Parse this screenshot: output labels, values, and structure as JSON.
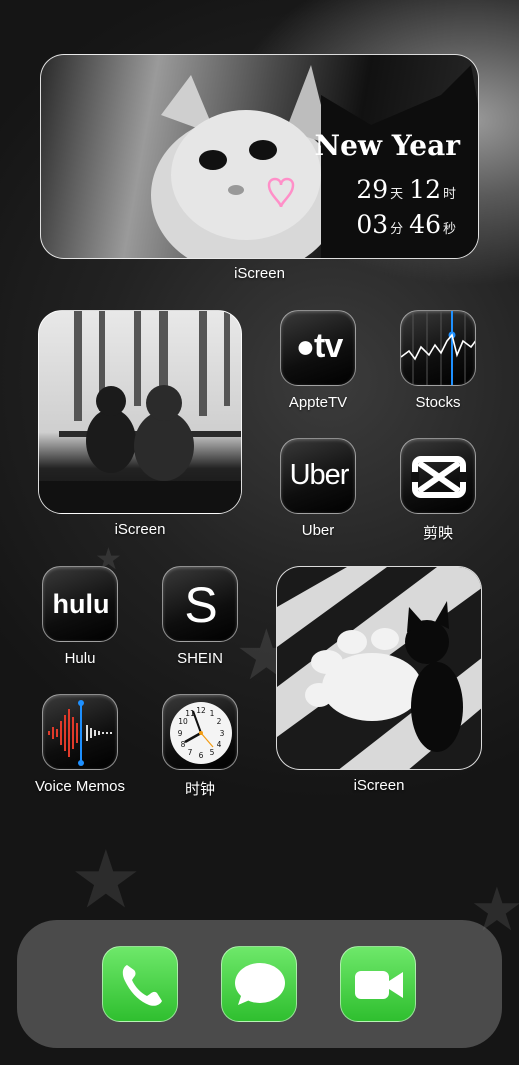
{
  "widgets": {
    "new_year": {
      "title": "New Year",
      "days": "29",
      "days_unit": "天",
      "hours": "12",
      "hours_unit": "时",
      "minutes": "03",
      "minutes_unit": "分",
      "seconds": "46",
      "seconds_unit": "秒",
      "label": "iScreen"
    },
    "snow_cats": {
      "label": "iScreen"
    },
    "black_cat": {
      "label": "iScreen"
    }
  },
  "apps": {
    "appletv": {
      "label": "AppteTV",
      "icon": "apple-tv-icon",
      "glyph_text": "tv"
    },
    "stocks": {
      "label": "Stocks",
      "icon": "stocks-icon"
    },
    "uber": {
      "label": "Uber",
      "icon": "uber-icon",
      "glyph_text": "Uber"
    },
    "capcut": {
      "label": "剪映",
      "icon": "capcut-icon"
    },
    "hulu": {
      "label": "Hulu",
      "icon": "hulu-icon",
      "glyph_text": "hulu"
    },
    "shein": {
      "label": "SHEIN",
      "icon": "shein-icon",
      "glyph_text": "S"
    },
    "voice_memos": {
      "label": "Voice Memos",
      "icon": "voice-memos-icon"
    },
    "clock": {
      "label": "时钟",
      "icon": "clock-icon"
    }
  },
  "dock": {
    "phone": {
      "icon": "phone-icon"
    },
    "messages": {
      "icon": "messages-icon"
    },
    "facetime": {
      "icon": "facetime-icon"
    }
  },
  "colors": {
    "dock_green": "#34c759",
    "accent_blue": "#1e90ff",
    "voice_red": "#e03a2a"
  }
}
